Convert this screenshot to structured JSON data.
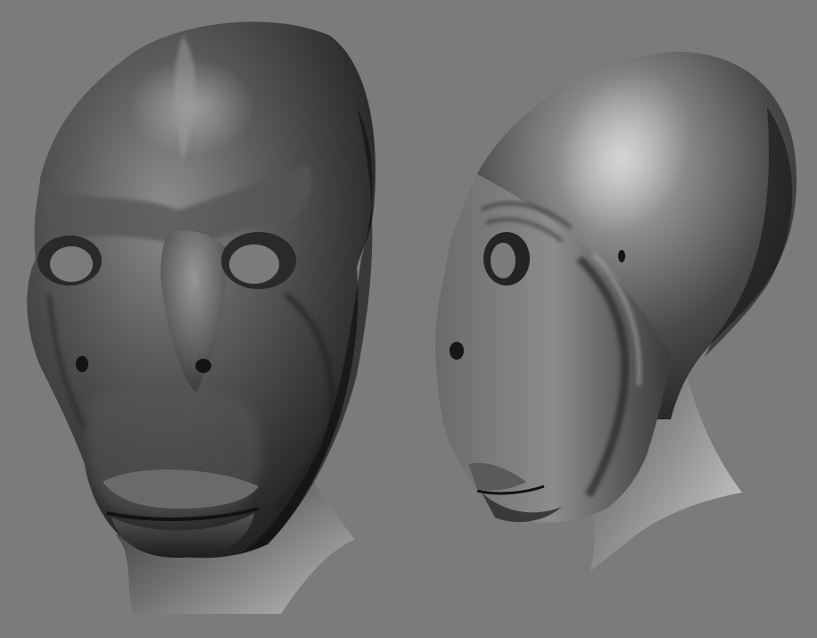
{
  "canvas": {
    "background_color": "#7b7b7b"
  },
  "render": {
    "material": "grey-clay",
    "highlight_color": "#d9d9d9",
    "shadow_color": "#111111"
  },
  "subjects": [
    {
      "id": "front-three-quarter-view"
    },
    {
      "id": "side-profile-view"
    }
  ]
}
